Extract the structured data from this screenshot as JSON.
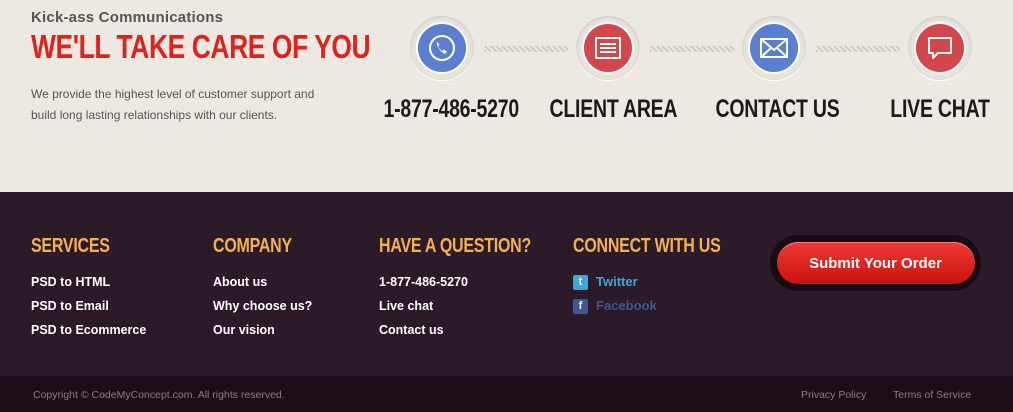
{
  "hero": {
    "kicker": "Kick-ass Communications",
    "headline": "WE'LL TAKE CARE OF YOU",
    "intro": "We provide the highest level of customer support and build long lasting relationships with our clients."
  },
  "contacts": [
    {
      "label": "1-877-486-5270",
      "icon": "phone-icon",
      "color": "#5b7fd0"
    },
    {
      "label": "CLIENT AREA",
      "icon": "client-area-icon",
      "color": "#d3464a"
    },
    {
      "label": "CONTACT US",
      "icon": "envelope-icon",
      "color": "#5b7fd0"
    },
    {
      "label": "LIVE CHAT",
      "icon": "chat-bubble-icon",
      "color": "#d3464a"
    }
  ],
  "footer": {
    "services": {
      "title": "SERVICES",
      "items": [
        "PSD to HTML",
        "PSD to Email",
        "PSD to Ecommerce"
      ]
    },
    "company": {
      "title": "COMPANY",
      "items": [
        "About us",
        "Why choose us?",
        "Our vision"
      ]
    },
    "question": {
      "title": "HAVE A QUESTION?",
      "items": [
        "1-877-486-5270",
        "Live chat",
        "Contact us"
      ]
    },
    "connect": {
      "title": "CONNECT WITH US",
      "twitter": "Twitter",
      "facebook": "Facebook"
    },
    "order_button": "Submit Your Order"
  },
  "bottom": {
    "copyright": "Copyright © CodeMyConcept.com. All rights reserved.",
    "privacy": "Privacy Policy",
    "terms": "Terms of Service"
  },
  "colors": {
    "accent_red": "#e0221b",
    "footer_gold": "#f4b246",
    "blue_icon": "#5b7fd0",
    "red_icon": "#d3464a"
  }
}
